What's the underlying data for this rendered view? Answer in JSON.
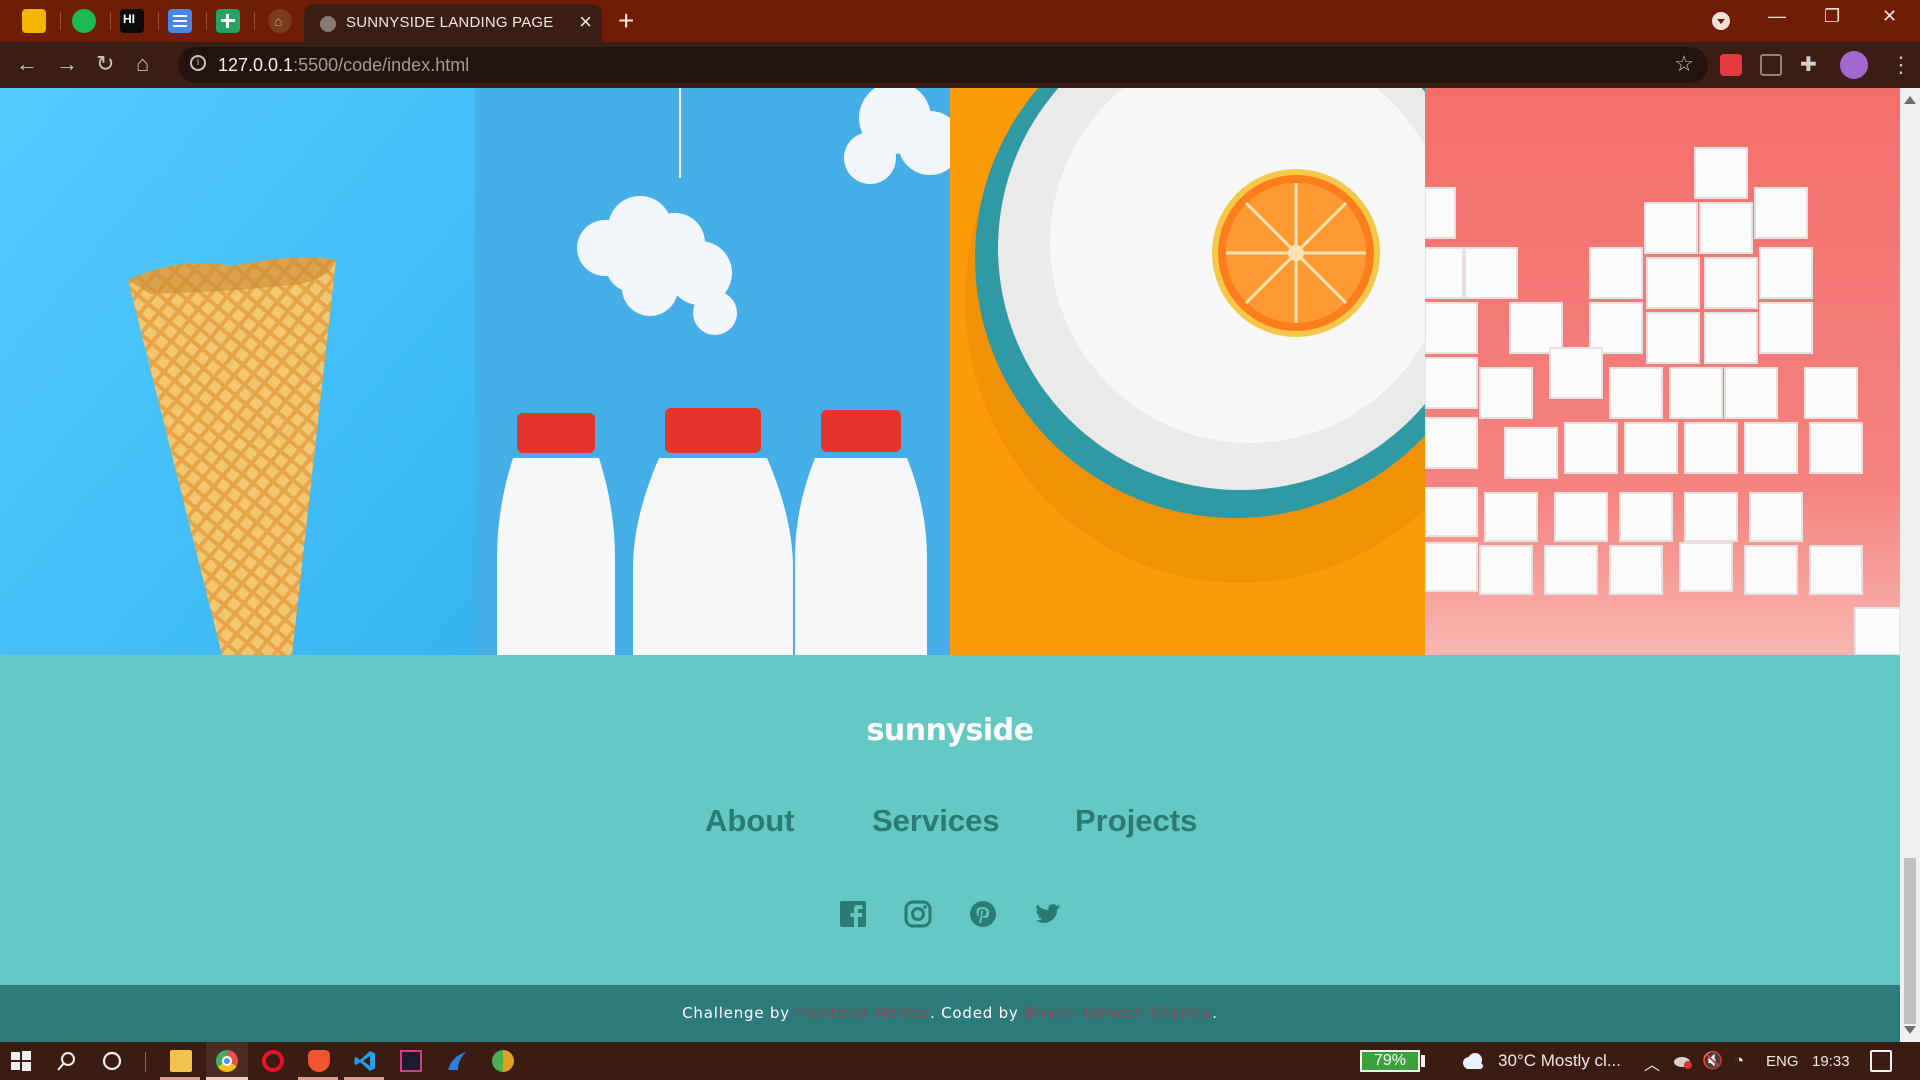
{
  "browser": {
    "tab_title": "SUNNYSIDE LANDING PAGE",
    "url_host": "127.0.0.1",
    "url_rest": ":5500/code/index.html",
    "pinned_tabs": [
      "keep-icon",
      "spotify-icon",
      "hackernoon-icon",
      "docs-icon",
      "sheets-icon",
      "profile-tab-icon"
    ],
    "window_controls": {
      "minimize": "—",
      "restore": "❐",
      "close": "✕"
    },
    "colors": {
      "tabstrip": "#6f1d05",
      "toolbar": "#3a1e14",
      "omnibox": "#231210"
    }
  },
  "gallery": {
    "images": [
      {
        "subject": "ice-cream-cone",
        "bg": "#4ec5f6"
      },
      {
        "subject": "milk-bottles",
        "bg": "#45aee6"
      },
      {
        "subject": "orange-on-plate",
        "bg": "#fd9a07"
      },
      {
        "subject": "sugar-cubes",
        "bg": "#f37a78"
      }
    ]
  },
  "footer": {
    "logo": "sunnyside",
    "nav": [
      "About",
      "Services",
      "Projects"
    ],
    "social": [
      "facebook-icon",
      "instagram-icon",
      "pinterest-icon",
      "twitter-icon"
    ],
    "bg": "#64c9c4",
    "nav_color": "#2c7a74"
  },
  "attribution": {
    "prefix": "Challenge by ",
    "frontend_mentor": "Frontend Mentor",
    "middle": ". Coded by ",
    "author": "Bhakti Ganesh Sharma",
    "suffix": ".",
    "bg": "#2c7b7a",
    "link_color": "#8d4a56"
  },
  "taskbar": {
    "battery": "79%",
    "weather": "30°C  Mostly cl...",
    "language": "ENG",
    "time": "19:33",
    "apps": [
      "file-explorer-icon",
      "chrome-icon",
      "opera-icon",
      "brave-icon",
      "vscode-icon",
      "intellij-icon",
      "edge-icon",
      "chrome-dev-icon"
    ]
  }
}
